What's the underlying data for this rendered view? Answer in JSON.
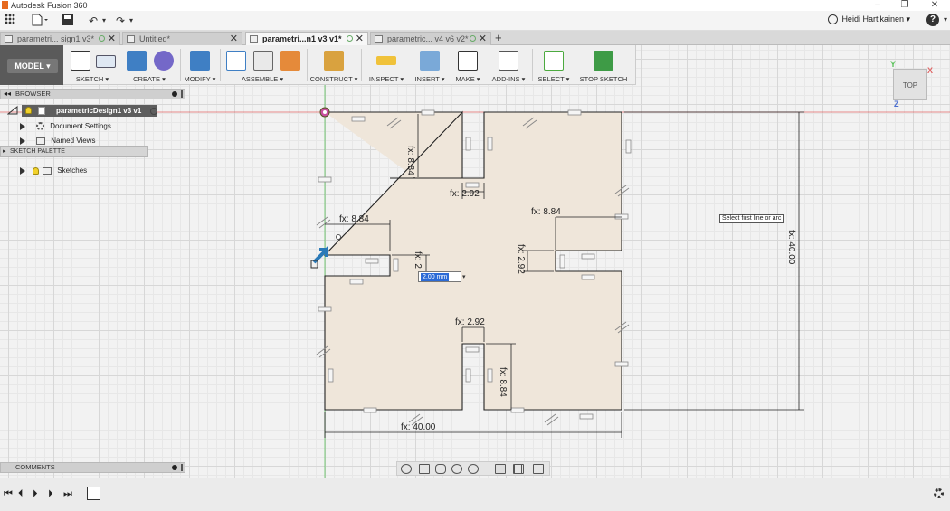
{
  "window": {
    "title": "Autodesk Fusion 360",
    "minimize": "–",
    "maximize": "❐",
    "close": "✕"
  },
  "quick_access": {
    "user": "Heidi Hartikainen ▾",
    "help": "?",
    "help_caret": "▾",
    "undo": "↶",
    "redo": "↷",
    "dropdown_caret": "▾"
  },
  "tabs": [
    {
      "label": "parametri... sign1 v3*",
      "active": false
    },
    {
      "label": "Untitled*",
      "active": false
    },
    {
      "label": "parametri...n1 v3 v1*",
      "active": true
    },
    {
      "label": "parametric... v4 v6 v2*",
      "active": false
    }
  ],
  "tab_close": "✕",
  "add_tab": "+",
  "toolbar": {
    "workspace": "MODEL ▾",
    "groups": [
      "SKETCH ▾",
      "CREATE ▾",
      "MODIFY ▾",
      "ASSEMBLE ▾",
      "CONSTRUCT ▾",
      "INSPECT ▾",
      "INSERT ▾",
      "MAKE ▾",
      "ADD-INS ▾",
      "SELECT ▾",
      "STOP SKETCH"
    ]
  },
  "browser": {
    "title": "BROWSER",
    "collapse": "◂◂",
    "root": "parametricDesign1 v3 v1",
    "items": [
      "Document Settings",
      "Named Views",
      "Sketches"
    ]
  },
  "sketch_palette": {
    "title": "SKETCH PALETTE",
    "arrow": "▸"
  },
  "comments": {
    "title": "COMMENTS"
  },
  "viewcube": {
    "face": "TOP",
    "x_label": "X",
    "y_label": "Y",
    "z_label": "Z"
  },
  "sketch": {
    "dimensions": [
      {
        "text": "fx: 8.84"
      },
      {
        "text": "fx: 2.92"
      },
      {
        "text": "fx: 8.84"
      },
      {
        "text": "fx: 8.84"
      },
      {
        "text": "fx: 2.92"
      },
      {
        "text": "fx: 2.92"
      },
      {
        "text": "fx: 8.84"
      },
      {
        "text": "fx: 40.00"
      },
      {
        "text": "fx: 40.00"
      },
      {
        "text": "fx: 2"
      }
    ],
    "input_value": "2.00 mm",
    "input_caret": "▾",
    "tooltip": "Select first line or arc"
  },
  "timeline": {
    "first": "⏮",
    "prev": "⏴",
    "play": "⏵",
    "next": "⏵",
    "last": "⏭"
  },
  "colors": {
    "sketch_fill": "#efe6da",
    "sketch_line": "#222222",
    "constraint": "#888888",
    "accent_blue": "#2c6bd6",
    "red_axis": "#e06666",
    "green_axis": "#59c159"
  }
}
